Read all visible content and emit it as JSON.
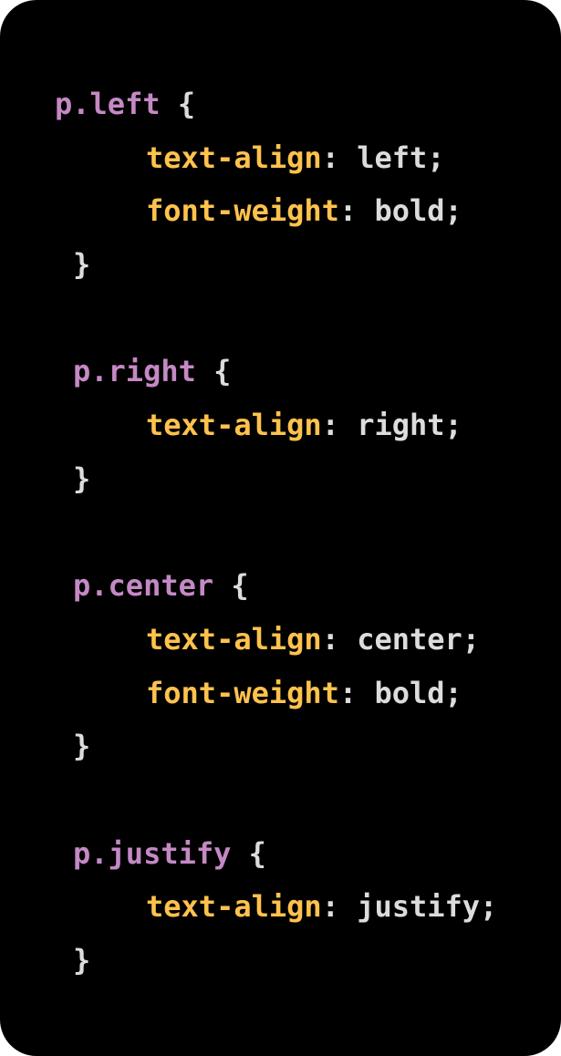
{
  "colors": {
    "background": "#000000",
    "selector": "#c489c4",
    "property": "#ffc24d",
    "value": "#dcdcdc"
  },
  "code": {
    "lines": [
      {
        "kind": "selector",
        "indent": 0,
        "selector": "p.left",
        "brace": "{"
      },
      {
        "kind": "declaration",
        "indent": 2,
        "property": "text-align",
        "value": "left"
      },
      {
        "kind": "declaration",
        "indent": 2,
        "property": "font-weight",
        "value": "bold"
      },
      {
        "kind": "close",
        "indent": 1,
        "brace": "}"
      },
      {
        "kind": "blank"
      },
      {
        "kind": "selector",
        "indent": 1,
        "selector": "p.right",
        "brace": "{"
      },
      {
        "kind": "declaration",
        "indent": 2,
        "property": "text-align",
        "value": "right"
      },
      {
        "kind": "close",
        "indent": 1,
        "brace": "}"
      },
      {
        "kind": "blank"
      },
      {
        "kind": "selector",
        "indent": 1,
        "selector": "p.center",
        "brace": "{"
      },
      {
        "kind": "declaration",
        "indent": 2,
        "property": "text-align",
        "value": "center"
      },
      {
        "kind": "declaration",
        "indent": 2,
        "property": "font-weight",
        "value": "bold"
      },
      {
        "kind": "close",
        "indent": 1,
        "brace": "}"
      },
      {
        "kind": "blank"
      },
      {
        "kind": "selector",
        "indent": 1,
        "selector": "p.justify",
        "brace": "{"
      },
      {
        "kind": "declaration",
        "indent": 2,
        "property": "text-align",
        "value": "justify"
      },
      {
        "kind": "close",
        "indent": 1,
        "brace": "}"
      }
    ]
  }
}
